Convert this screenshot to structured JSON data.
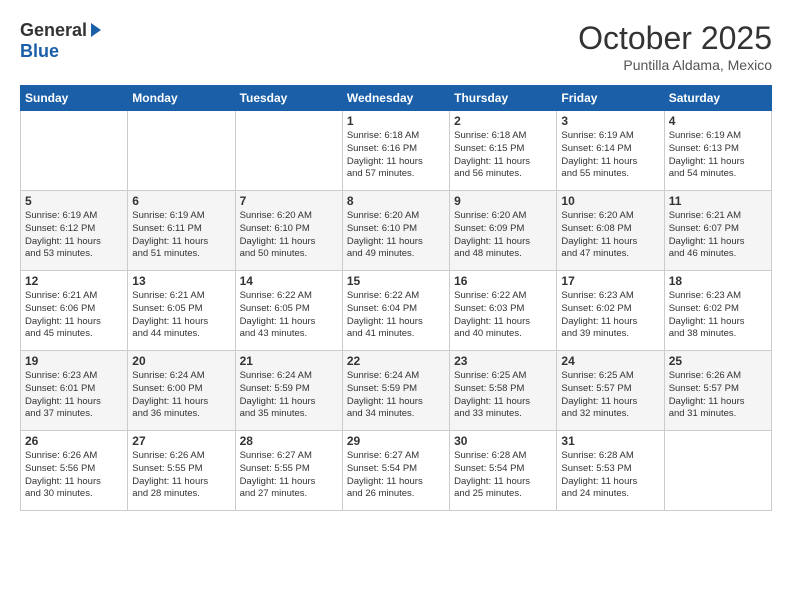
{
  "logo": {
    "general": "General",
    "blue": "Blue"
  },
  "title": "October 2025",
  "subtitle": "Puntilla Aldama, Mexico",
  "days_of_week": [
    "Sunday",
    "Monday",
    "Tuesday",
    "Wednesday",
    "Thursday",
    "Friday",
    "Saturday"
  ],
  "weeks": [
    [
      {
        "day": "",
        "info": ""
      },
      {
        "day": "",
        "info": ""
      },
      {
        "day": "",
        "info": ""
      },
      {
        "day": "1",
        "info": "Sunrise: 6:18 AM\nSunset: 6:16 PM\nDaylight: 11 hours\nand 57 minutes."
      },
      {
        "day": "2",
        "info": "Sunrise: 6:18 AM\nSunset: 6:15 PM\nDaylight: 11 hours\nand 56 minutes."
      },
      {
        "day": "3",
        "info": "Sunrise: 6:19 AM\nSunset: 6:14 PM\nDaylight: 11 hours\nand 55 minutes."
      },
      {
        "day": "4",
        "info": "Sunrise: 6:19 AM\nSunset: 6:13 PM\nDaylight: 11 hours\nand 54 minutes."
      }
    ],
    [
      {
        "day": "5",
        "info": "Sunrise: 6:19 AM\nSunset: 6:12 PM\nDaylight: 11 hours\nand 53 minutes."
      },
      {
        "day": "6",
        "info": "Sunrise: 6:19 AM\nSunset: 6:11 PM\nDaylight: 11 hours\nand 51 minutes."
      },
      {
        "day": "7",
        "info": "Sunrise: 6:20 AM\nSunset: 6:10 PM\nDaylight: 11 hours\nand 50 minutes."
      },
      {
        "day": "8",
        "info": "Sunrise: 6:20 AM\nSunset: 6:10 PM\nDaylight: 11 hours\nand 49 minutes."
      },
      {
        "day": "9",
        "info": "Sunrise: 6:20 AM\nSunset: 6:09 PM\nDaylight: 11 hours\nand 48 minutes."
      },
      {
        "day": "10",
        "info": "Sunrise: 6:20 AM\nSunset: 6:08 PM\nDaylight: 11 hours\nand 47 minutes."
      },
      {
        "day": "11",
        "info": "Sunrise: 6:21 AM\nSunset: 6:07 PM\nDaylight: 11 hours\nand 46 minutes."
      }
    ],
    [
      {
        "day": "12",
        "info": "Sunrise: 6:21 AM\nSunset: 6:06 PM\nDaylight: 11 hours\nand 45 minutes."
      },
      {
        "day": "13",
        "info": "Sunrise: 6:21 AM\nSunset: 6:05 PM\nDaylight: 11 hours\nand 44 minutes."
      },
      {
        "day": "14",
        "info": "Sunrise: 6:22 AM\nSunset: 6:05 PM\nDaylight: 11 hours\nand 43 minutes."
      },
      {
        "day": "15",
        "info": "Sunrise: 6:22 AM\nSunset: 6:04 PM\nDaylight: 11 hours\nand 41 minutes."
      },
      {
        "day": "16",
        "info": "Sunrise: 6:22 AM\nSunset: 6:03 PM\nDaylight: 11 hours\nand 40 minutes."
      },
      {
        "day": "17",
        "info": "Sunrise: 6:23 AM\nSunset: 6:02 PM\nDaylight: 11 hours\nand 39 minutes."
      },
      {
        "day": "18",
        "info": "Sunrise: 6:23 AM\nSunset: 6:02 PM\nDaylight: 11 hours\nand 38 minutes."
      }
    ],
    [
      {
        "day": "19",
        "info": "Sunrise: 6:23 AM\nSunset: 6:01 PM\nDaylight: 11 hours\nand 37 minutes."
      },
      {
        "day": "20",
        "info": "Sunrise: 6:24 AM\nSunset: 6:00 PM\nDaylight: 11 hours\nand 36 minutes."
      },
      {
        "day": "21",
        "info": "Sunrise: 6:24 AM\nSunset: 5:59 PM\nDaylight: 11 hours\nand 35 minutes."
      },
      {
        "day": "22",
        "info": "Sunrise: 6:24 AM\nSunset: 5:59 PM\nDaylight: 11 hours\nand 34 minutes."
      },
      {
        "day": "23",
        "info": "Sunrise: 6:25 AM\nSunset: 5:58 PM\nDaylight: 11 hours\nand 33 minutes."
      },
      {
        "day": "24",
        "info": "Sunrise: 6:25 AM\nSunset: 5:57 PM\nDaylight: 11 hours\nand 32 minutes."
      },
      {
        "day": "25",
        "info": "Sunrise: 6:26 AM\nSunset: 5:57 PM\nDaylight: 11 hours\nand 31 minutes."
      }
    ],
    [
      {
        "day": "26",
        "info": "Sunrise: 6:26 AM\nSunset: 5:56 PM\nDaylight: 11 hours\nand 30 minutes."
      },
      {
        "day": "27",
        "info": "Sunrise: 6:26 AM\nSunset: 5:55 PM\nDaylight: 11 hours\nand 28 minutes."
      },
      {
        "day": "28",
        "info": "Sunrise: 6:27 AM\nSunset: 5:55 PM\nDaylight: 11 hours\nand 27 minutes."
      },
      {
        "day": "29",
        "info": "Sunrise: 6:27 AM\nSunset: 5:54 PM\nDaylight: 11 hours\nand 26 minutes."
      },
      {
        "day": "30",
        "info": "Sunrise: 6:28 AM\nSunset: 5:54 PM\nDaylight: 11 hours\nand 25 minutes."
      },
      {
        "day": "31",
        "info": "Sunrise: 6:28 AM\nSunset: 5:53 PM\nDaylight: 11 hours\nand 24 minutes."
      },
      {
        "day": "",
        "info": ""
      }
    ]
  ]
}
